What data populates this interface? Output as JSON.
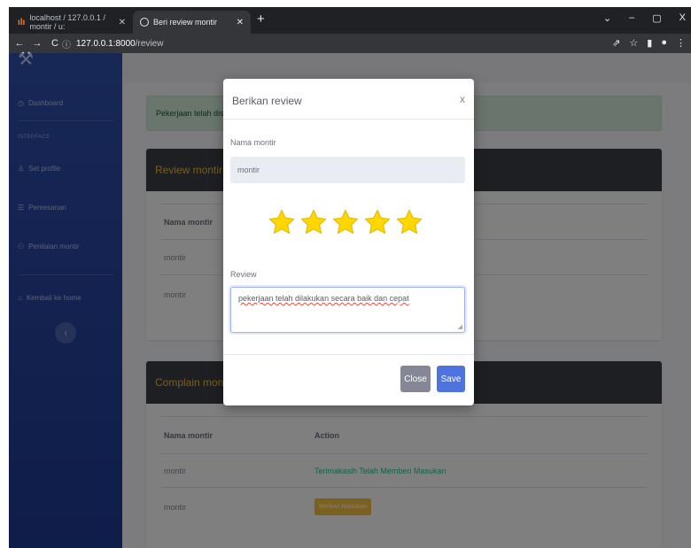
{
  "browser": {
    "tabs": [
      {
        "title": "localhost / 127.0.0.1 / montir / u:",
        "active": false
      },
      {
        "title": "Beri review montir",
        "active": true
      }
    ],
    "url_host": "127.0.0.1:8000",
    "url_path": "/review"
  },
  "sidebar": {
    "items": [
      {
        "label": "Dashboard",
        "icon": "dashboard-icon"
      },
      {
        "label": "Set profile",
        "icon": "user-icon"
      },
      {
        "label": "Pemesanan",
        "icon": "list-icon"
      },
      {
        "label": "Penilaian montir",
        "icon": "users-icon"
      },
      {
        "label": "Kembali ke home",
        "icon": "home-icon"
      }
    ],
    "heading": "INTERFACE",
    "toggle_icon": "chevron-left-icon"
  },
  "main": {
    "alert": "Pekerjaan telah dis",
    "review_card": {
      "title": "Review montir",
      "header": "Nama montir",
      "rows": [
        "montir",
        "montir"
      ]
    },
    "complain_card": {
      "title": "Complain mon",
      "headers": [
        "Nama montir",
        "Action"
      ],
      "rows": [
        {
          "name": "montir",
          "action": "Terimakasih Telah Memberi Masukan"
        },
        {
          "name": "montir",
          "action": "Berikan Masukan"
        }
      ]
    }
  },
  "modal": {
    "title": "Berikan review",
    "close_glyph": "x",
    "name_label": "Nama montir",
    "name_value": "montir",
    "rating": 5,
    "rating_max": 5,
    "star_color": "#ffd700",
    "review_label": "Review",
    "review_value": "pekerjaan telah dilakukan secara baik dan cepat",
    "close_button": "Close",
    "save_button": "Save"
  }
}
